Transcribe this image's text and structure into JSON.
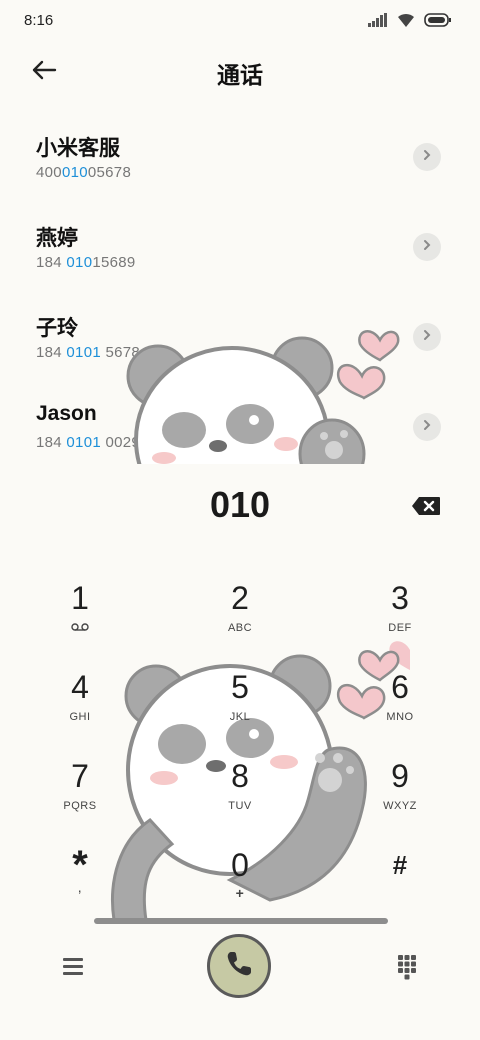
{
  "status_bar": {
    "time": "8:16",
    "icons": [
      "signal-icon",
      "wifi-icon",
      "battery-icon"
    ]
  },
  "header": {
    "title": "通话",
    "back_icon": "arrow-left-icon"
  },
  "contacts": [
    {
      "name": "小米客服",
      "number_pre": "400",
      "number_hl": "010",
      "number_post": "05678"
    },
    {
      "name": "燕婷",
      "number_pre": "184 ",
      "number_hl": "010",
      "number_post": "15689"
    },
    {
      "name": "子玲",
      "number_pre": "184 ",
      "number_hl": "0101",
      "number_post": " 5678"
    },
    {
      "name": "Jason",
      "number_pre": "184 ",
      "number_hl": "0101",
      "number_post": " 0029"
    }
  ],
  "dialer": {
    "entered_number": "010",
    "backspace_icon": "backspace-icon"
  },
  "keypad": [
    {
      "digit": "1",
      "letters": "ᴏᴏ",
      "sub_icon": "voicemail-icon"
    },
    {
      "digit": "2",
      "letters": "ABC"
    },
    {
      "digit": "3",
      "letters": "DEF"
    },
    {
      "digit": "4",
      "letters": "GHI"
    },
    {
      "digit": "5",
      "letters": "JKL"
    },
    {
      "digit": "6",
      "letters": "MNO"
    },
    {
      "digit": "7",
      "letters": "PQRS"
    },
    {
      "digit": "8",
      "letters": "TUV"
    },
    {
      "digit": "9",
      "letters": "WXYZ"
    },
    {
      "digit": "*",
      "letters": ","
    },
    {
      "digit": "0",
      "letters": "+"
    },
    {
      "digit": "#",
      "letters": ""
    }
  ],
  "bottom_bar": {
    "menu_icon": "menu-icon",
    "call_icon": "phone-icon",
    "keypad_icon": "dialpad-icon"
  },
  "colors": {
    "background": "#fbfaf6",
    "highlight": "#1e8fd8",
    "call_button": "#c6c9a4",
    "detail_button": "#e7e7e4"
  }
}
